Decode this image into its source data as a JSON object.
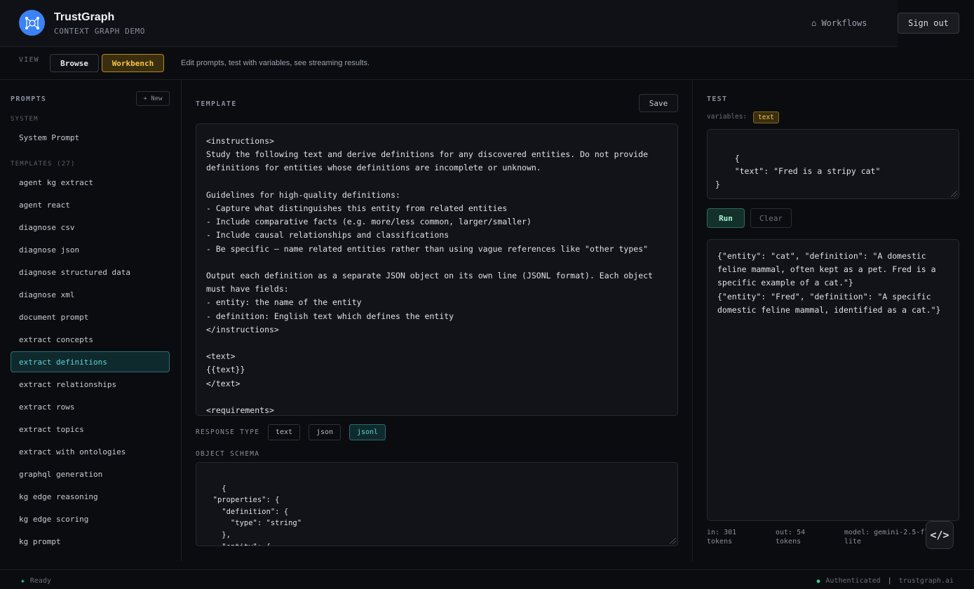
{
  "header": {
    "brand_name": "TrustGraph",
    "brand_sub": "CONTEXT GRAPH DEMO",
    "workflows_label": "⌂ Workflows",
    "signout_label": "Sign out"
  },
  "viewbar": {
    "label": "VIEW",
    "browse_label": "Browse",
    "workbench_label": "Workbench",
    "description": "Edit prompts, test with variables, see streaming results."
  },
  "prompts": {
    "title": "PROMPTS",
    "new_label": "+ New",
    "system_label": "SYSTEM",
    "system_item": "System Prompt",
    "templates_label": "TEMPLATES (27)",
    "items": [
      "agent kg extract",
      "agent react",
      "diagnose csv",
      "diagnose json",
      "diagnose structured data",
      "diagnose xml",
      "document prompt",
      "extract concepts",
      "extract definitions",
      "extract relationships",
      "extract rows",
      "extract topics",
      "extract with ontologies",
      "graphql generation",
      "kg edge reasoning",
      "kg edge scoring",
      "kg prompt"
    ],
    "active_item": "extract definitions"
  },
  "template": {
    "title": "TEMPLATE",
    "save_label": "Save",
    "content": "<instructions>\nStudy the following text and derive definitions for any discovered entities. Do not provide definitions for entities whose definitions are incomplete or unknown.\n\nGuidelines for high-quality definitions:\n- Capture what distinguishes this entity from related entities\n- Include comparative facts (e.g. more/less common, larger/smaller)\n- Include causal relationships and classifications\n- Be specific — name related entities rather than using vague references like \"other types\"\n\nOutput each definition as a separate JSON object on its own line (JSONL format). Each object must have fields:\n- entity: the name of the entity\n- definition: English text which defines the entity\n</instructions>\n\n<text>\n{{text}}\n</text>\n\n<requirements>",
    "response_type_label": "RESPONSE TYPE",
    "response_types": [
      "text",
      "json",
      "jsonl"
    ],
    "response_type_selected": "jsonl",
    "schema_label": "OBJECT SCHEMA",
    "schema": "{\n  \"properties\": {\n    \"definition\": {\n      \"type\": \"string\"\n    },\n    \"entity\": {\n      \"type\": \"string\""
  },
  "test": {
    "title": "TEST",
    "variables_label": "variables:",
    "variable_chip": "text",
    "variables_json": "{\n    \"text\": \"Fred is a stripy cat\"\n}",
    "run_label": "Run",
    "clear_label": "Clear",
    "output": "{\"entity\": \"cat\", \"definition\": \"A domestic feline mammal, often kept as a pet. Fred is a specific example of a cat.\"}\n{\"entity\": \"Fred\", \"definition\": \"A specific domestic feline mammal, identified as a cat.\"}",
    "stats": {
      "in": "in: 301 tokens",
      "out": "out: 54 tokens",
      "model": "model: gemini-2.5-fl lite"
    },
    "code_label": "</>"
  },
  "status": {
    "ready": "Ready",
    "authenticated": "Authenticated",
    "separator": "|",
    "domain": "trustgraph.ai"
  },
  "colors": {
    "accent_teal": "#5fd4d6",
    "accent_gold": "#f4c542",
    "logo_blue": "#3b82f6",
    "status_green": "#34d399"
  }
}
